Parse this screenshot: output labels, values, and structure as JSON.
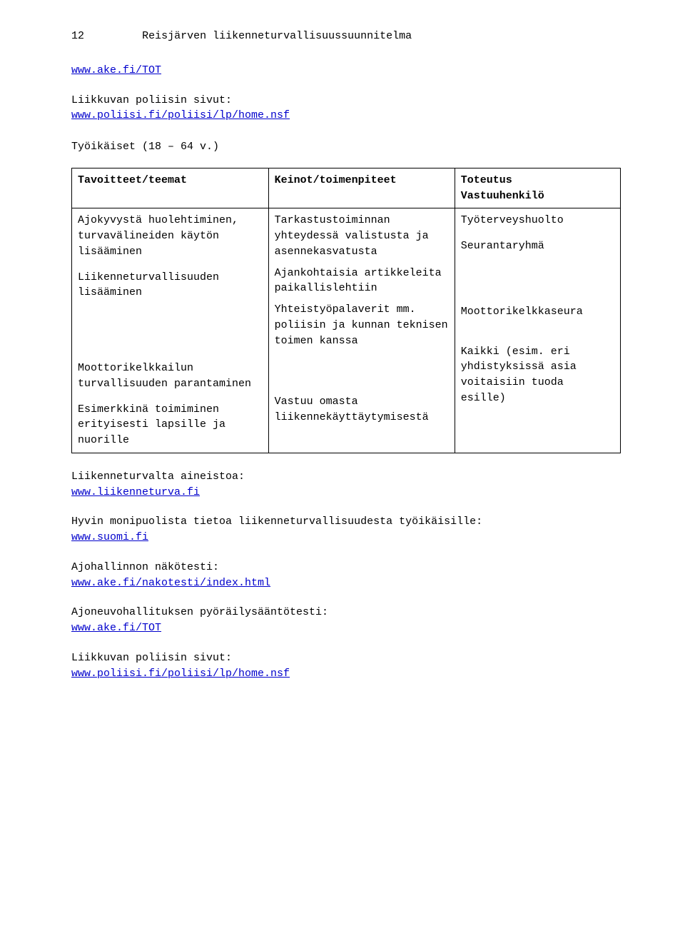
{
  "page_number": "12",
  "title": "Reisjärven liikenneturvallisuussuunnitelma",
  "link_tot": "www.ake.fi/TOT",
  "police_heading": "Liikkuvan poliisin sivut:",
  "police_link": "www.poliisi.fi/poliisi/lp/home.nsf",
  "age_heading": "Työikäiset (18 – 64 v.)",
  "table": {
    "header": {
      "c1": "Tavoitteet/teemat",
      "c2": "Keinot/toimenpiteet",
      "c3a": "Toteutus",
      "c3b": "Vastuuhenkilö"
    },
    "row": {
      "c1a": "Ajokyvystä huolehtiminen, turvavälineiden käytön lisääminen",
      "c1b": "Liikenneturvallisuuden lisääminen",
      "c1c": "Moottorikelkkailun turvallisuuden parantaminen",
      "c1d": "Esimerkkinä toimiminen erityisesti lapsille ja nuorille",
      "c2a": "Tarkastustoiminnan yhteydessä valistusta ja asennekasvatusta",
      "c2b": "Ajankohtaisia artikkeleita paikallislehtiin",
      "c2c": "Yhteistyöpalaverit mm. poliisin ja kunnan teknisen toimen kanssa",
      "c2d": "Vastuu omasta liikennekäyttäytymisestä",
      "c3x": "Työterveyshuolto",
      "c3y": "Seurantaryhmä",
      "c3z": "Moottorikelkkaseura",
      "c3w": "Kaikki (esim. eri yhdistyksissä asia voitaisiin tuoda esille)"
    }
  },
  "footer": {
    "l1a": "Liikenneturvalta aineistoa:",
    "l1b": "www.liikenneturva.fi",
    "l2a": "Hyvin monipuolista tietoa liikenneturvallisuudesta työikäisille:",
    "l2b": "www.suomi.fi",
    "l3a": "Ajohallinnon näkötesti:",
    "l3b": "www.ake.fi/nakotesti/index.html",
    "l4a": "Ajoneuvohallituksen pyöräilysääntötesti:",
    "l4b": "www.ake.fi/TOT",
    "l5a": "Liikkuvan poliisin sivut:",
    "l5b": "www.poliisi.fi/poliisi/lp/home.nsf"
  }
}
